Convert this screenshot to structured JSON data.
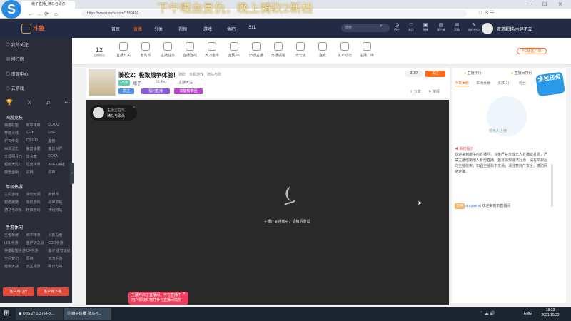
{
  "browser": {
    "tab_title": "峨子直播_骑马与砍杀",
    "url": "https://www.douyu.com/7559491",
    "overlay_text": "下午喋血复仇，晚上骑砍2新档"
  },
  "topnav": {
    "items": [
      "首页",
      "直播",
      "分类",
      "视频",
      "游戏",
      "鱼吧",
      "S11"
    ],
    "search_placeholder": "搜索",
    "icons": [
      "历史",
      "关注",
      "开播",
      "客户端",
      "活动",
      "创作中心"
    ],
    "username": "弯道超越/木建不立"
  },
  "sidebar": {
    "top_items": [
      "我的关注",
      "排行榜",
      "资源中心",
      "云游戏"
    ],
    "group_titles": [
      "网游竞技",
      "单机热游",
      "手游休闲"
    ],
    "net_games": [
      "英雄联盟",
      "和平精英",
      "DOTA2",
      "穿越火线",
      "CF/H",
      "DNF",
      "炉石传说",
      "CS:GO",
      "魔兽",
      "lol沉浸之",
      "魔兽争霸",
      "魔兽世界",
      "天涯明月刀",
      "逆水寒",
      "DOTA",
      "超级大乱斗",
      "坦克世界",
      "APEX英雄",
      "魔兽全明",
      "战网",
      "原神"
    ],
    "single_games": [
      "主机游戏",
      "永劫无间",
      "新世界",
      "超级跑酷",
      "单机游戏",
      "战神单机",
      "骑马与砍杀",
      "怀旧游戏",
      "神秘网站"
    ],
    "mobile_games": [
      "王者荣耀",
      "和平精英",
      "火影忍者",
      "LOL手游",
      "金铲铲之战",
      "COD手游",
      "英雄联盟手游",
      "CF手游",
      "崩坏:星穹铁道",
      "空间梦幻",
      "原神",
      "天刀手游",
      "植物大战",
      "双生视界",
      "明日方舟"
    ],
    "bottom_buttons": [
      "客户端打开",
      "客户端下载"
    ]
  },
  "categories": {
    "count": "12",
    "count_label": "主播粉丝",
    "items": [
      "直播开关",
      "老虎币",
      "主播任务",
      "直播连线",
      "大力金币",
      "全民PK",
      "旧版直播",
      "开播提醒",
      "十七级",
      "连麦",
      "发布动态",
      "主播二维"
    ]
  },
  "room": {
    "title": "骑砍2：极致战争体验！",
    "category": "骑砍",
    "tags": [
      "单机游戏",
      "骑马与砍"
    ],
    "host": "峨子",
    "host_level": "LV35",
    "weight": "56.4kg",
    "extra": "主播天注",
    "badges": [
      "关注",
      "福利直播",
      "高能帮帮团"
    ],
    "viewers": "3187",
    "follow_btn": "关注",
    "share": "分享",
    "report": "举报"
  },
  "player": {
    "corner_line1": "主播正在玩",
    "corner_line2": "骑马与砍杀",
    "status": "主播正在连线中，请稍后重试"
  },
  "toast": {
    "line1": "主播开启了直播间，可在直播中",
    "line2": "用户领取礼物并参与直播间抽奖"
  },
  "right": {
    "rank_label": "主播排行",
    "rank_right": "直播间排行",
    "tabs": [
      "今日贡献",
      "本周贡献",
      "贵宾(1)",
      "粉丝"
    ],
    "promo": "全民任务",
    "pc_btn": "PC版客户端",
    "sys_label": "系统提示",
    "sys_msg": "欢迎来到峨子的直播间。斗鱼严禁未成年人直播或打赏，严禁主播借用他人身份直播。若有违规违法行为，请在举报后向主播核实。如遇主播私下交易，请注意财产安全，谨防网络诈骗。",
    "welcome_tag": "日常",
    "welcome_user": "aoqiwend",
    "welcome_msg": "欢迎来到本直播间",
    "watermark": "暂无人上榜"
  },
  "taskbar": {
    "apps": [
      "OBS 27.1.3 (64-bi...",
      "峨子直播_骑马与..."
    ],
    "time": "18:13",
    "date": "2021/10/22",
    "lang": "ENG"
  }
}
